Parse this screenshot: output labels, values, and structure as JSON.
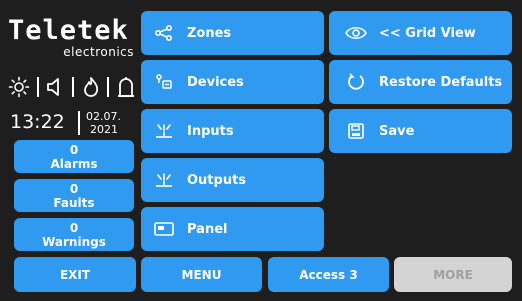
{
  "brand": {
    "name": "Teletek",
    "subtitle": "electronics"
  },
  "status_icons": [
    "sun-icon",
    "speaker-icon",
    "flame-icon",
    "siren-icon"
  ],
  "clock": {
    "time": "13:22",
    "date_line1": "02.07.",
    "date_line2": "2021"
  },
  "counters": [
    {
      "count": "0",
      "label": "Alarms"
    },
    {
      "count": "0",
      "label": "Faults"
    },
    {
      "count": "0",
      "label": "Warnings"
    }
  ],
  "menu_left": [
    {
      "label": "Zones",
      "icon": "zones-icon"
    },
    {
      "label": "Devices",
      "icon": "devices-icon"
    },
    {
      "label": "Inputs",
      "icon": "inputs-icon"
    },
    {
      "label": "Outputs",
      "icon": "outputs-icon"
    },
    {
      "label": "Panel",
      "icon": "panel-icon"
    }
  ],
  "menu_right": [
    {
      "label": "<< Grid View",
      "icon": "eye-icon"
    },
    {
      "label": "Restore Defaults",
      "icon": "restore-icon"
    },
    {
      "label": "Save",
      "icon": "save-icon"
    }
  ],
  "bottom_bar": {
    "exit": "EXIT",
    "menu": "MENU",
    "access": "Access 3",
    "more": "MORE"
  },
  "colors": {
    "background": "#1e1e1e",
    "button": "#2f9aef",
    "disabled": "#d4d4d4",
    "text": "#ffffff"
  }
}
